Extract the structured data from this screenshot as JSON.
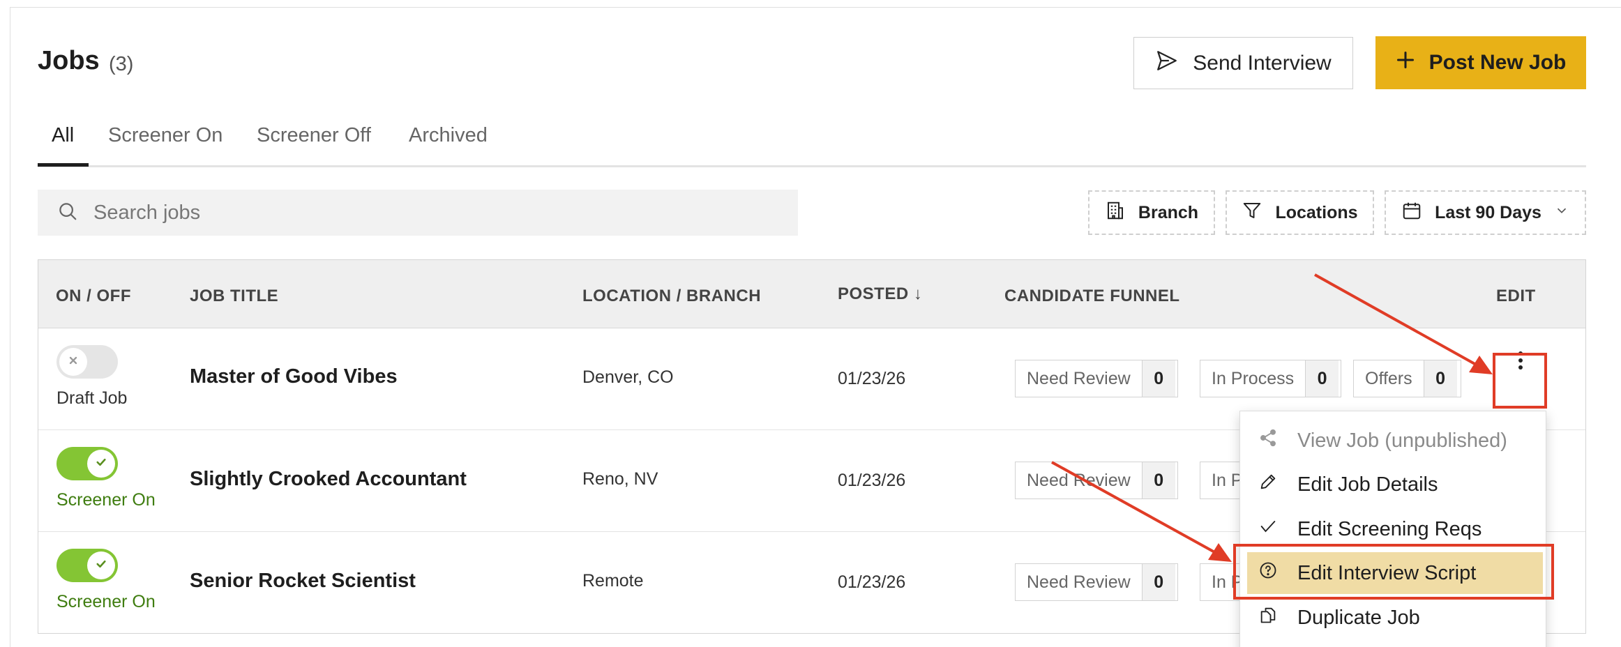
{
  "header": {
    "title": "Jobs",
    "count": "(3)",
    "send_interview_label": "Send Interview",
    "post_job_label": "Post New Job"
  },
  "tabs": [
    {
      "label": "All",
      "active": true
    },
    {
      "label": "Screener On",
      "active": false
    },
    {
      "label": "Screener Off",
      "active": false
    },
    {
      "label": "Archived",
      "active": false
    }
  ],
  "search": {
    "placeholder": "Search jobs",
    "value": ""
  },
  "filters": {
    "branch": "Branch",
    "locations": "Locations",
    "date_range": "Last 90 Days"
  },
  "table": {
    "columns": {
      "on_off": "ON / OFF",
      "job_title": "JOB TITLE",
      "location": "LOCATION / BRANCH",
      "posted": "POSTED ↓",
      "funnel": "CANDIDATE FUNNEL",
      "edit": "EDIT"
    },
    "rows": [
      {
        "status": "Draft Job",
        "toggle_on": false,
        "title": "Master of Good Vibes",
        "location": "Denver, CO",
        "posted": "01/23/26",
        "funnel": [
          {
            "label": "Need Review",
            "count": "0"
          },
          {
            "label": "In Process",
            "count": "0"
          },
          {
            "label": "Offers",
            "count": "0"
          }
        ]
      },
      {
        "status": "Screener On",
        "toggle_on": true,
        "title": "Slightly Crooked Accountant",
        "location": "Reno, NV",
        "posted": "01/23/26",
        "funnel": [
          {
            "label": "Need Review",
            "count": "0"
          },
          {
            "label": "In P",
            "count": ""
          }
        ]
      },
      {
        "status": "Screener On",
        "toggle_on": true,
        "title": "Senior Rocket Scientist",
        "location": "Remote",
        "posted": "01/23/26",
        "funnel": [
          {
            "label": "Need Review",
            "count": "0"
          },
          {
            "label": "In P",
            "count": ""
          }
        ]
      }
    ]
  },
  "menu": {
    "items": [
      {
        "label": "View Job (unpublished)",
        "icon": "share-icon",
        "disabled": true
      },
      {
        "label": "Edit Job Details",
        "icon": "pencil-icon",
        "disabled": false
      },
      {
        "label": "Edit Screening Reqs",
        "icon": "check-icon",
        "disabled": false
      },
      {
        "label": "Edit Interview Script",
        "icon": "question-circle-icon",
        "highlighted": true
      },
      {
        "label": "Duplicate Job",
        "icon": "copy-icon",
        "disabled": false
      }
    ]
  },
  "colors": {
    "accent": "#e8b117",
    "toggle_on": "#84c534",
    "screener_on_text": "#3f7d10",
    "menu_highlight": "#f0dca5",
    "annotation_red": "#e03c26"
  }
}
